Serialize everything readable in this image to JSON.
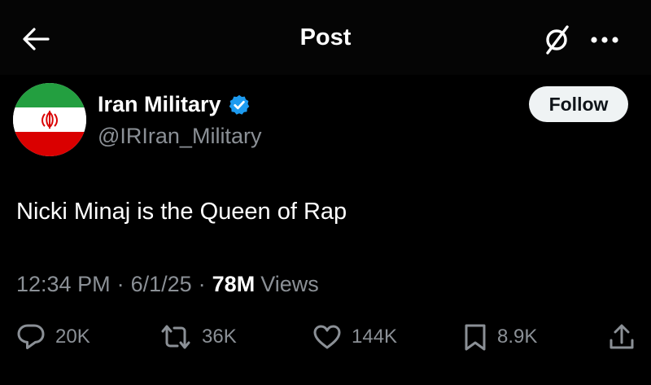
{
  "header": {
    "title": "Post",
    "back_icon": "back-arrow-icon",
    "grok_icon": "grok-icon",
    "more_icon": "more-dots-icon"
  },
  "author": {
    "name": "Iran Military",
    "handle": "@IRIran_Military",
    "verified": true,
    "verified_color": "#1d9bf0",
    "avatar_icon": "iran-flag-avatar"
  },
  "follow_label": "Follow",
  "post": {
    "text": "Nicki Minaj is the Queen of Rap",
    "time": "12:34 PM",
    "date": "6/1/25",
    "views_count": "78M",
    "views_label": "Views",
    "separator": "·"
  },
  "actions": {
    "replies": "20K",
    "reposts": "36K",
    "likes": "144K",
    "bookmarks": "8.9K"
  },
  "colors": {
    "background": "#000000",
    "muted_text": "#8b9096",
    "flag_green": "#239f40",
    "flag_red": "#da0000"
  }
}
